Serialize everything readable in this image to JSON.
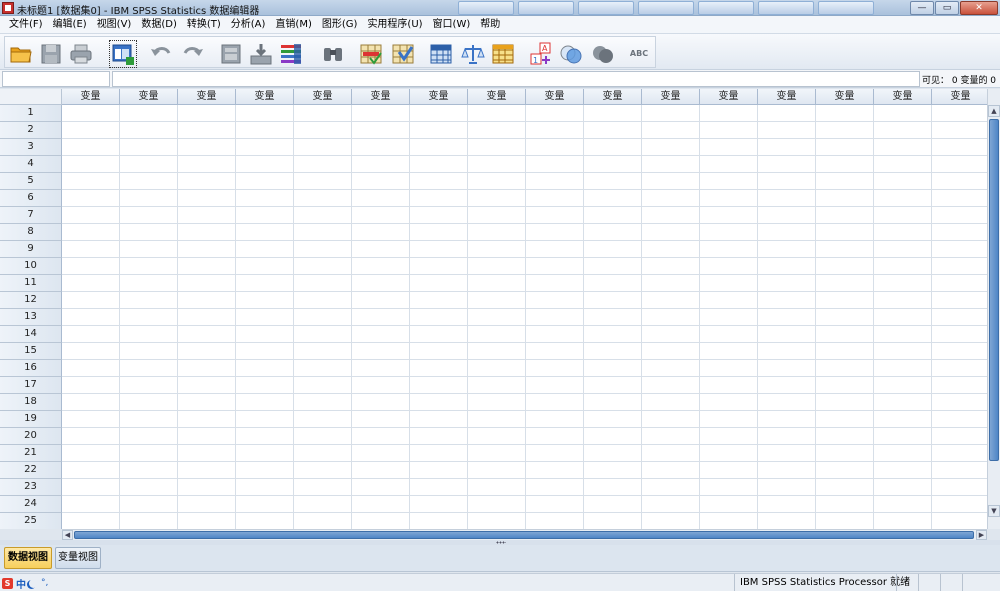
{
  "window": {
    "title": "未标题1 [数据集0] - IBM SPSS Statistics 数据编辑器",
    "controls": [
      "—",
      "▭",
      "✕"
    ]
  },
  "menu": [
    "文件(F)",
    "编辑(E)",
    "视图(V)",
    "数据(D)",
    "转换(T)",
    "分析(A)",
    "直销(M)",
    "图形(G)",
    "实用程序(U)",
    "窗口(W)",
    "帮助"
  ],
  "toolbar": {
    "icons": [
      "open-folder-icon",
      "save-icon",
      "print-icon",
      "dialog-recall-icon",
      "undo-icon",
      "redo-icon",
      "goto-case-icon",
      "goto-variable-icon",
      "variables-icon",
      "find-icon",
      "insert-cases-icon",
      "insert-variable-icon",
      "split-file-icon",
      "weight-cases-icon",
      "select-cases-icon",
      "value-labels-icon",
      "use-variable-sets-icon",
      "show-all-variables-icon",
      "spell-check-icon"
    ],
    "spell_label": "ABC"
  },
  "editor": {
    "cell_ref": "",
    "cell_value": "",
    "visible_count": "可见： 0 变量的 0"
  },
  "grid": {
    "column_header": "变量",
    "columns": [
      "变量",
      "变量",
      "变量",
      "变量",
      "变量",
      "变量",
      "变量",
      "变量",
      "变量",
      "变量",
      "变量",
      "变量",
      "变量",
      "变量",
      "变量",
      "变量"
    ],
    "rows": [
      "1",
      "2",
      "3",
      "4",
      "5",
      "6",
      "7",
      "8",
      "9",
      "10",
      "11",
      "12",
      "13",
      "14",
      "15",
      "16",
      "17",
      "18",
      "19",
      "20",
      "21",
      "22",
      "23",
      "24",
      "25"
    ]
  },
  "tabs": {
    "data_view": "数据视图",
    "variable_view": "变量视图"
  },
  "status": {
    "ime_logo": "S",
    "ime_lang": "中",
    "ime_punct": "°,",
    "processor": "IBM SPSS Statistics Processor 就绪"
  },
  "colors": {
    "accent": "#4f86c6",
    "active_tab": "#f7cf5c"
  }
}
